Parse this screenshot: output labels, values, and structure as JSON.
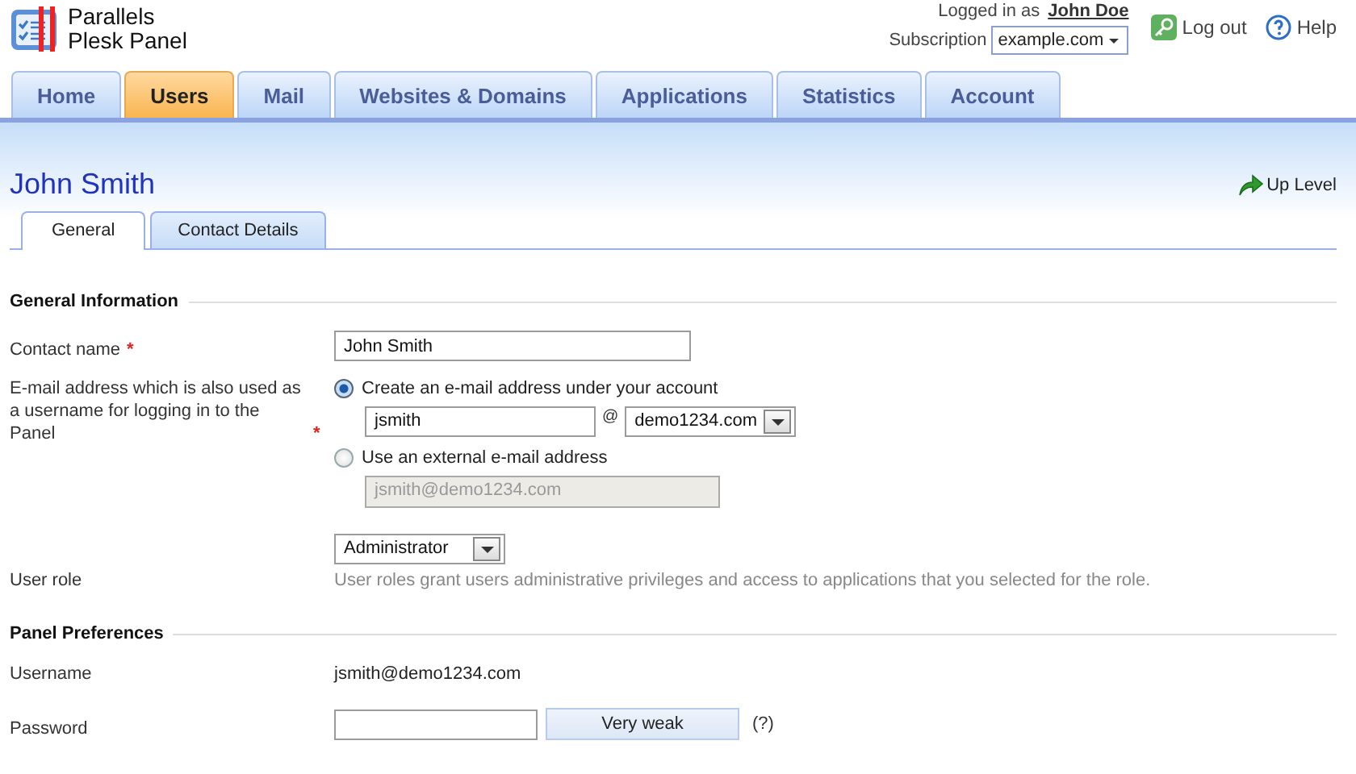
{
  "header": {
    "logo_lines": [
      "Parallels",
      "Plesk Panel"
    ],
    "logged_in_label": "Logged in as",
    "user": "John Doe",
    "subscription_label": "Subscription",
    "subscription": "example.com",
    "logout": "Log out",
    "help": "Help"
  },
  "tabs": [
    {
      "label": "Home",
      "selected": false
    },
    {
      "label": "Users",
      "selected": true
    },
    {
      "label": "Mail",
      "selected": false
    },
    {
      "label": "Websites & Domains",
      "selected": false
    },
    {
      "label": "Applications",
      "selected": false
    },
    {
      "label": "Statistics",
      "selected": false
    },
    {
      "label": "Account",
      "selected": false
    }
  ],
  "page": {
    "title": "John Smith",
    "up_level": "Up Level"
  },
  "subtabs": [
    {
      "label": "General",
      "selected": true
    },
    {
      "label": "Contact Details",
      "selected": false
    }
  ],
  "sections": [
    {
      "title": "General Information",
      "rows": [
        {
          "kind": "text",
          "label": "Contact name",
          "required_mark": "*",
          "value": "John Smith"
        },
        {
          "kind": "email",
          "label": "E-mail address which is also used as a username for logging in to the Panel",
          "required_mark": "*",
          "options": [
            {
              "kind": "local",
              "label": "Create an e-mail address under your account",
              "selected": true,
              "value": "jsmith",
              "at": "@",
              "domain": "demo1234.com"
            },
            {
              "kind": "external",
              "label": "Use an external e-mail address",
              "selected": false,
              "value": "jsmith@demo1234.com",
              "disabled": true
            }
          ]
        },
        {
          "kind": "select",
          "label": "User role",
          "value": "Administrator",
          "hint": "User roles grant users administrative privileges and access to applications that you selected for the role."
        }
      ]
    },
    {
      "title": "Panel Preferences",
      "rows": [
        {
          "kind": "static",
          "label": "Username",
          "value": "jsmith@demo1234.com"
        },
        {
          "kind": "password",
          "label": "Password",
          "strength": "Very weak",
          "help": "(?)"
        }
      ]
    }
  ]
}
